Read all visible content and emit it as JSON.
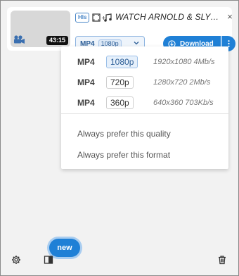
{
  "media": {
    "badge": "Hls",
    "duration": "43:15",
    "title": "WATCH ARNOLD & SLY: ...",
    "close_label": "×",
    "selected_format": "MP4",
    "selected_quality": "1080p",
    "download_label": "Download"
  },
  "dropdown": {
    "options": [
      {
        "format": "MP4",
        "quality": "1080p",
        "desc": "1920x1080 4Mb/s",
        "selected": true
      },
      {
        "format": "MP4",
        "quality": "720p",
        "desc": "1280x720 2Mb/s",
        "selected": false
      },
      {
        "format": "MP4",
        "quality": "360p",
        "desc": "640x360 703Kb/s",
        "selected": false
      }
    ],
    "prefer_quality": "Always prefer this quality",
    "prefer_format": "Always prefer this format"
  },
  "footer": {
    "new_label": "new"
  },
  "icons": [
    "video-camera-icon",
    "film-music-icon",
    "chevron-down-icon",
    "download-icon",
    "more-vertical-icon",
    "gear-icon",
    "panel-icon",
    "trash-icon"
  ],
  "colors": {
    "accent": "#1f80d6",
    "accent_light": "#a9cdf0",
    "hls": "#4a87c8"
  }
}
